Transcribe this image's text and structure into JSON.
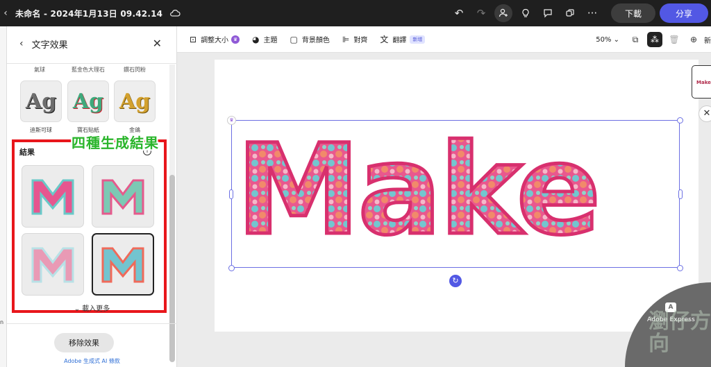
{
  "topbar": {
    "doc_title": "未命名 - 2024年1月13日 09.42.14",
    "download_label": "下載",
    "share_label": "分享",
    "icons": [
      "chevron-left-icon",
      "cloud-icon",
      "undo-icon",
      "redo-icon",
      "add-person-icon",
      "lightbulb-icon",
      "comment-icon",
      "copy-icon",
      "more-icon"
    ]
  },
  "left_strip": {
    "text": "n"
  },
  "panel": {
    "title": "文字效果",
    "top_labels": [
      "氣球",
      "藍金色大理石",
      "鑽石閃粉"
    ],
    "styles": [
      {
        "glyph": "Ag",
        "label": "迪斯可球",
        "color": "#6d6d6d"
      },
      {
        "glyph": "Ag",
        "label": "寶石貼紙",
        "color": "#3fa97c"
      },
      {
        "glyph": "Ag",
        "label": "金鴿",
        "color": "#d3a12e"
      }
    ],
    "results_title": "結果",
    "results_info": "i",
    "results_count": 4,
    "selected_result": 4,
    "load_more_label": "載入更多",
    "remove_label": "移除效果",
    "ai_terms": "Adobe 生成式 AI 條款"
  },
  "annotation": {
    "text": "四種生成結果",
    "color": "#2ab52b",
    "box_color": "#e8161b"
  },
  "toolbar": {
    "resize_label": "調整大小",
    "theme_label": "主題",
    "bg_color_label": "背景顏色",
    "align_label": "對齊",
    "translate_label": "翻譯",
    "new_badge": "新增",
    "zoom_label": "50%",
    "cut_label": "新"
  },
  "canvas": {
    "word": "Make",
    "page_thumb_text": "Make",
    "badge_text": "Adobe Express",
    "watermark_text": "瀏仔方向"
  }
}
